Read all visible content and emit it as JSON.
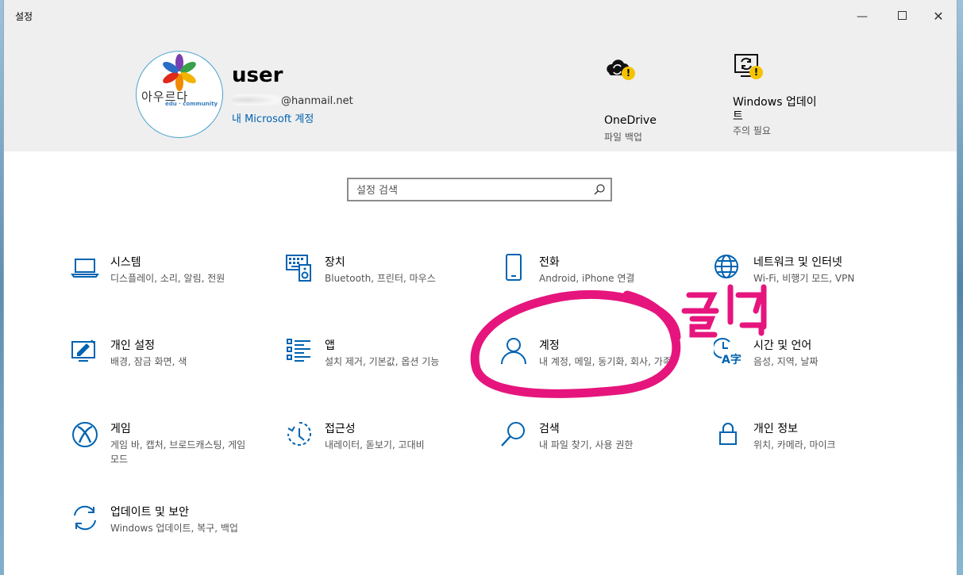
{
  "window": {
    "title": "설정"
  },
  "header": {
    "user": {
      "name": "user",
      "email_suffix": "@hanmail.net",
      "account_link": "내 Microsoft 계정",
      "avatar_text": "아우르다",
      "avatar_subtext": "edu · community"
    },
    "onedrive": {
      "label": "OneDrive",
      "status": "파일 백업",
      "icon": "cloud-sync-icon"
    },
    "windows_update": {
      "label_line1": "Windows 업데이",
      "label_line2": "트",
      "status": "주의 필요",
      "icon": "update-refresh-icon"
    }
  },
  "search": {
    "placeholder": "설정 검색"
  },
  "tiles": [
    {
      "title": "시스템",
      "desc": "디스플레이, 소리, 알림, 전원",
      "icon": "laptop-icon"
    },
    {
      "title": "장치",
      "desc": "Bluetooth, 프린터, 마우스",
      "icon": "keyboard-speaker-icon"
    },
    {
      "title": "전화",
      "desc": "Android, iPhone 연결",
      "icon": "phone-icon"
    },
    {
      "title": "네트워크 및 인터넷",
      "desc": "Wi-Fi, 비행기 모드, VPN",
      "icon": "globe-icon"
    },
    {
      "title": "개인 설정",
      "desc": "배경, 잠금 화면, 색",
      "icon": "personalize-icon"
    },
    {
      "title": "앱",
      "desc": "설치 제거, 기본값, 옵션 기능",
      "icon": "app-list-icon"
    },
    {
      "title": "계정",
      "desc": "내 계정, 메일, 동기화, 회사, 가족",
      "icon": "person-icon"
    },
    {
      "title": "시간 및 언어",
      "desc": "음성, 지역, 날짜",
      "icon": "time-language-icon"
    },
    {
      "title": "게임",
      "desc": "게임 바, 캡처, 브로드캐스팅, 게임 모드",
      "icon": "xbox-icon"
    },
    {
      "title": "접근성",
      "desc": "내레이터, 돋보기, 고대비",
      "icon": "ease-of-access-icon"
    },
    {
      "title": "검색",
      "desc": "내 파일 찾기, 사용 권한",
      "icon": "search-magnifier-icon"
    },
    {
      "title": "개인 정보",
      "desc": "위치, 카메라, 마이크",
      "icon": "lock-icon"
    },
    {
      "title": "업데이트 및 보안",
      "desc": "Windows 업데이트, 복구, 백업",
      "icon": "sync-arrows-icon"
    }
  ],
  "annotation": {
    "text": "클릭",
    "color": "#e6157d"
  },
  "colors": {
    "accent": "#0063b1",
    "warning": "#f3c300",
    "highlight": "#e6157d"
  }
}
